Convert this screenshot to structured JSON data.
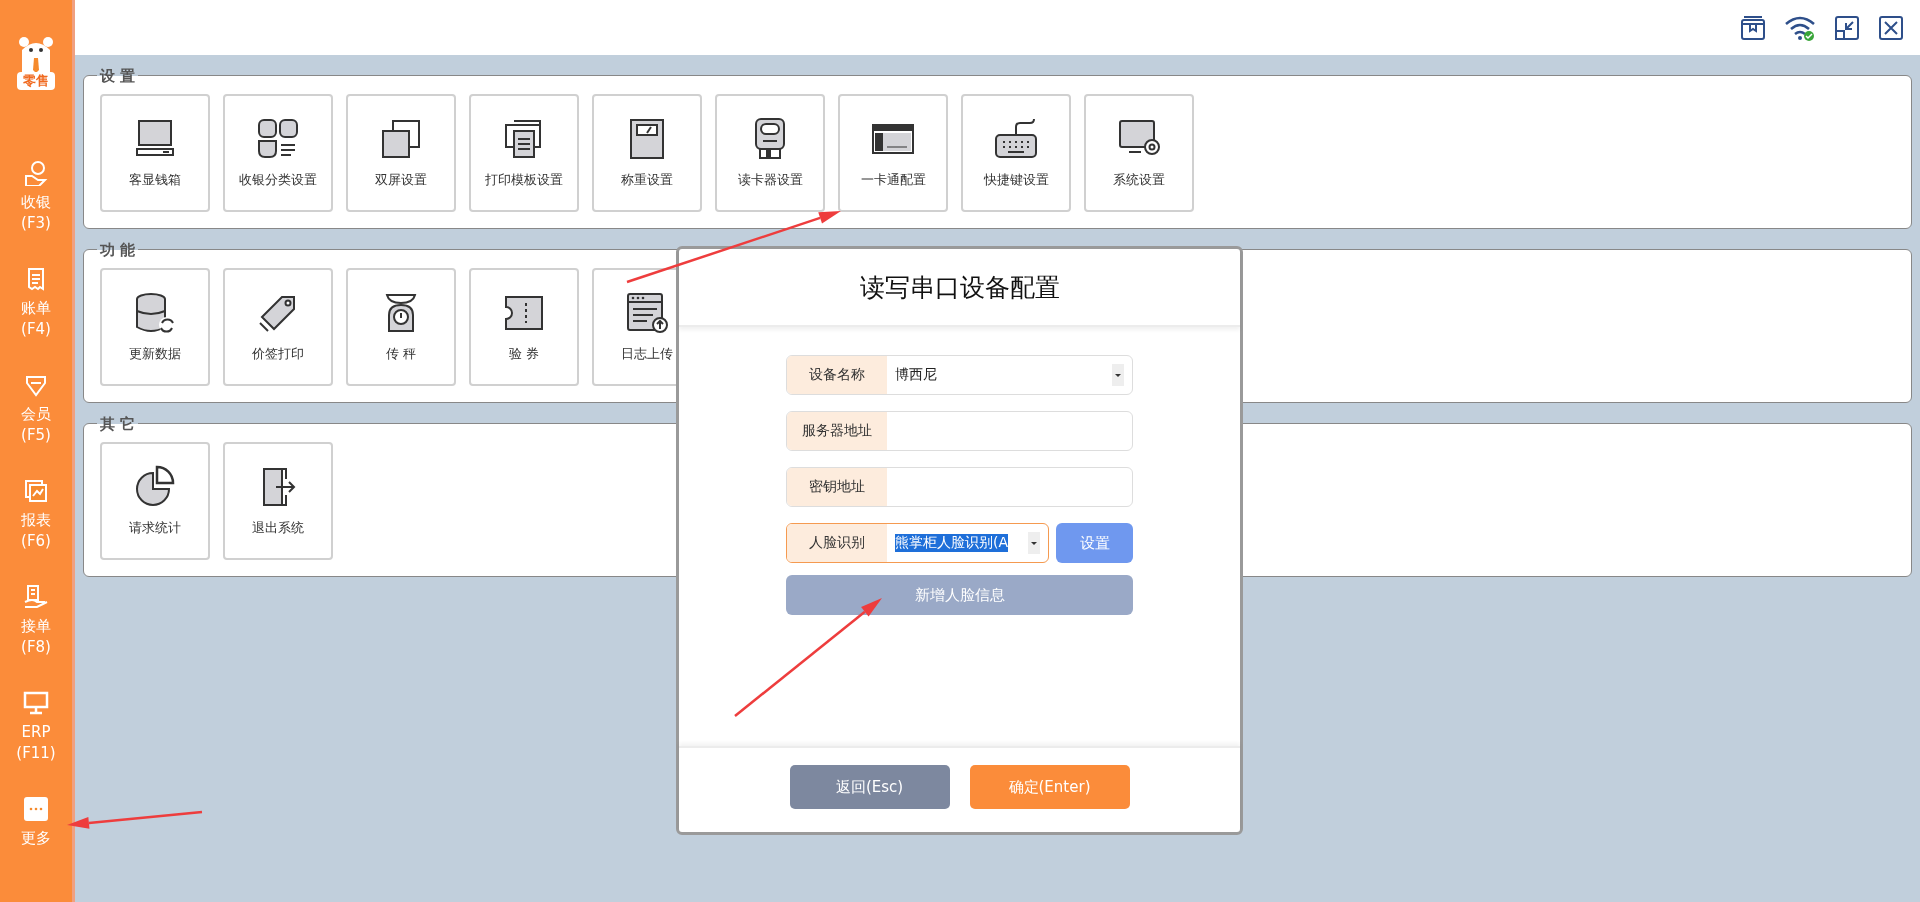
{
  "sidebar": {
    "logo_text": "零售",
    "items": [
      {
        "label": "收银",
        "shortcut": "(F3)"
      },
      {
        "label": "账单",
        "shortcut": "(F4)"
      },
      {
        "label": "会员",
        "shortcut": "(F5)"
      },
      {
        "label": "报表",
        "shortcut": "(F6)"
      },
      {
        "label": "接单",
        "shortcut": "(F8)"
      },
      {
        "label": "ERP",
        "shortcut": "(F11)"
      },
      {
        "label": "更多"
      }
    ]
  },
  "sections": [
    {
      "title": "设 置",
      "tiles": [
        "客显钱箱",
        "收银分类设置",
        "双屏设置",
        "打印模板设置",
        "称重设置",
        "读卡器设置",
        "一卡通配置",
        "快捷键设置",
        "系统设置"
      ]
    },
    {
      "title": "功 能",
      "tiles": [
        "更新数据",
        "价签打印",
        "传 秤",
        "验 券",
        "日志上传"
      ]
    },
    {
      "title": "其 它",
      "tiles": [
        "请求统计",
        "退出系统"
      ]
    }
  ],
  "dialog": {
    "title": "读写串口设备配置",
    "fields": [
      {
        "label": "设备名称",
        "kind": "select",
        "value": "博西尼",
        "focused": false
      },
      {
        "label": "服务器地址",
        "kind": "text",
        "focused": false
      },
      {
        "label": "密钥地址",
        "kind": "text",
        "focused": false
      },
      {
        "label": "人脸识别",
        "kind": "select",
        "value": "熊掌柜人脸识别(A",
        "focused": true,
        "action": "设置"
      }
    ],
    "add_button": "新增人脸信息",
    "cancel_button": "返回(Esc)",
    "ok_button": "确定(Enter)"
  }
}
